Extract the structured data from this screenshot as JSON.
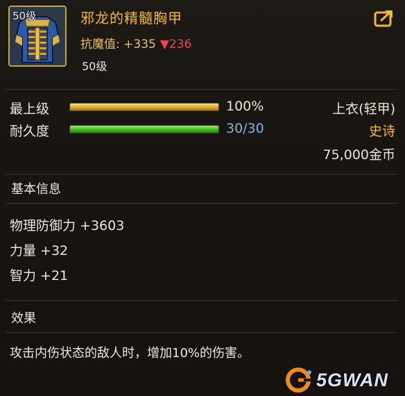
{
  "item": {
    "icon_level": "50级",
    "name": "邪龙的精髓胸甲",
    "resist_label": "抗魔值:",
    "resist_value": "+335",
    "resist_diff": "▼236",
    "required_level": "50级"
  },
  "stats": {
    "upgrade_label": "最上级",
    "upgrade_value": "100%",
    "upgrade_fraction": 1.0,
    "durability_label": "耐久度",
    "durability_value": "30/30",
    "durability_fraction": 1.0,
    "slot": "上衣(轻甲)",
    "rarity": "史诗",
    "price": "75,000金币"
  },
  "basic_info": {
    "title": "基本信息",
    "attributes": [
      "物理防御力 +3603",
      "力量 +32",
      "智力 +21"
    ]
  },
  "effect": {
    "title": "效果",
    "text": "攻击内伤状态的敌人时，增加10%的伤害。"
  },
  "watermark": {
    "text": "5GWAN"
  },
  "colors": {
    "title": "#f2b737",
    "rarity": "#f2b737",
    "diff_down": "#e8494a",
    "durability_value": "#8ab0e0",
    "frame_gold": "#c9a14a"
  },
  "icons": [
    "chest-armor-icon",
    "share-icon",
    "down-arrow-icon",
    "watermark-logo-icon"
  ]
}
